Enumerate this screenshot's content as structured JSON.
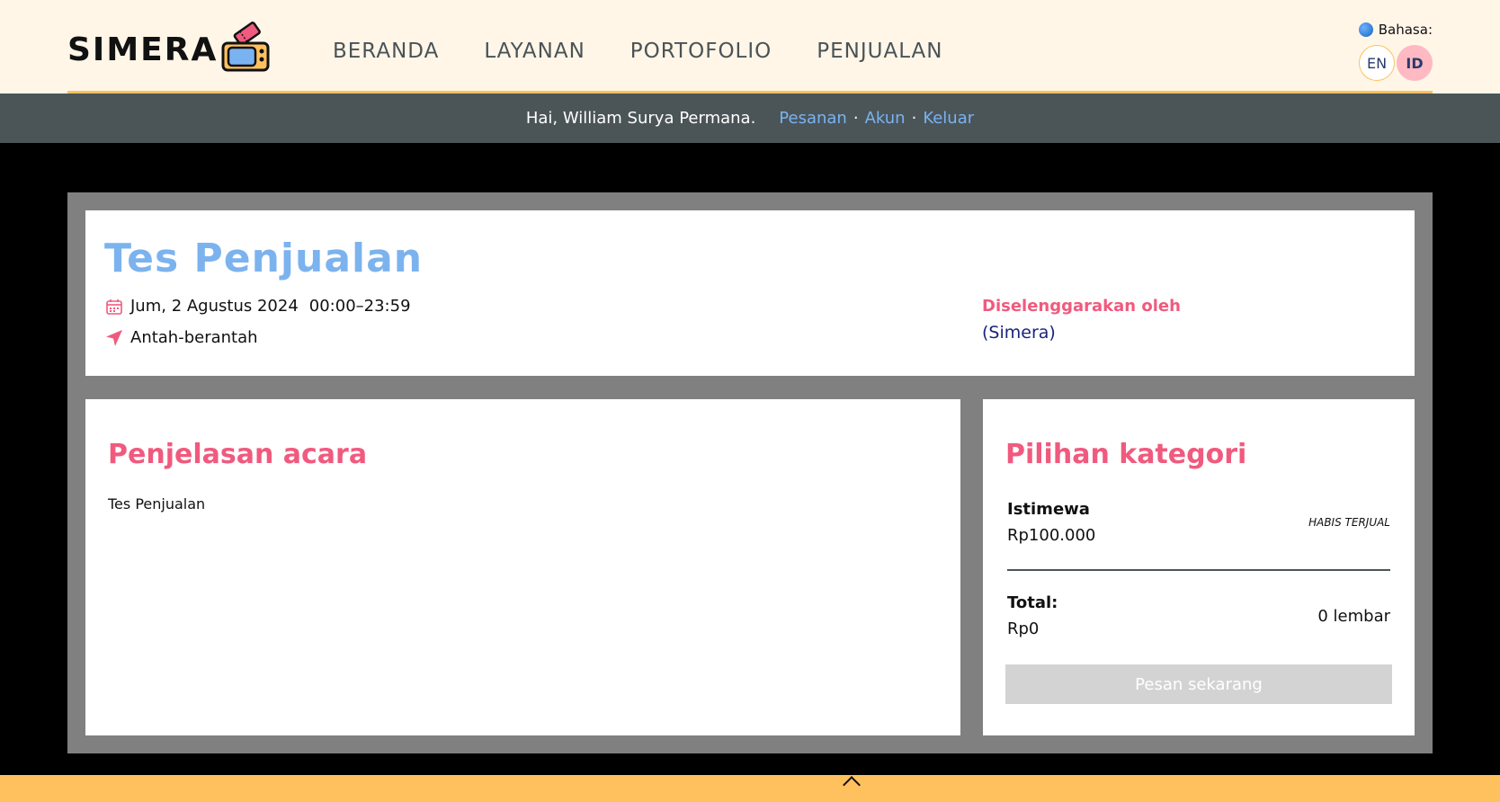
{
  "header": {
    "logo_text": "SIMERA",
    "nav": [
      "BERANDA",
      "LAYANAN",
      "PORTOFOLIO",
      "PENJUALAN"
    ],
    "language": {
      "label": "Bahasa:",
      "options": [
        "EN",
        "ID"
      ],
      "selected": "ID"
    }
  },
  "userbar": {
    "greeting": "Hai, William Surya Permana.",
    "links": [
      "Pesanan",
      "Akun",
      "Keluar"
    ],
    "separator": "·"
  },
  "event": {
    "title": "Tes Penjualan",
    "date": "Jum, 2 Agustus 2024",
    "time": "00:00–23:59",
    "location": "Antah-berantah",
    "organizer_label": "Diselenggarakan oleh",
    "organizer_name": "(Simera)"
  },
  "description": {
    "heading": "Penjelasan acara",
    "text": "Tes Penjualan"
  },
  "categories": {
    "heading": "Pilihan kategori",
    "items": [
      {
        "name": "Istimewa",
        "price": "Rp100.000",
        "status": "HABIS TERJUAL"
      }
    ],
    "total_label": "Total:",
    "total_value": "Rp0",
    "quantity": "0 lembar",
    "order_button": "Pesan sekarang"
  },
  "colors": {
    "accent_pink": "#f05a7e",
    "title_blue": "#7cb3ee",
    "header_bg": "#fff6e8",
    "footer_bg": "#ffc15e",
    "userbar_bg": "#4b5558"
  }
}
